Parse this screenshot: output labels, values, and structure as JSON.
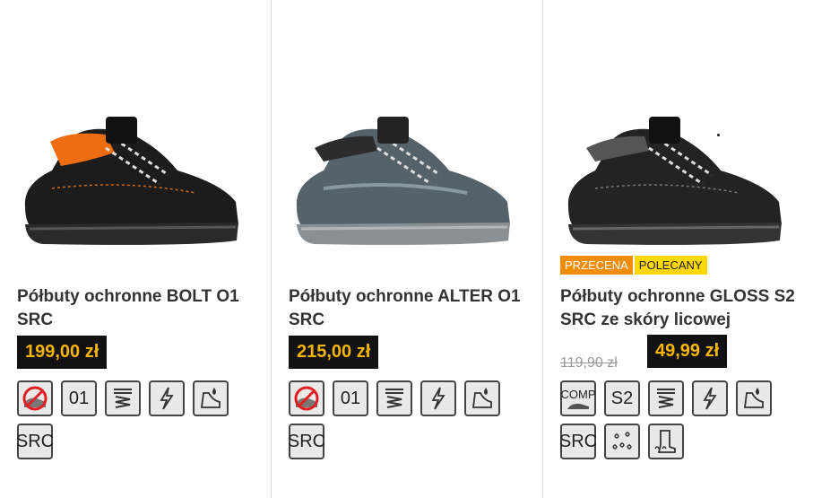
{
  "products": [
    {
      "title": "Półbuty ochronne BOLT O1 SRC",
      "price": "199,00 zł",
      "icons": [
        "no-steel-toe-icon",
        "o1-icon",
        "shock-absorption-icon",
        "antistatic-icon",
        "fuel-oil-resistance-icon",
        "src-icon"
      ],
      "icon_labels": [
        "",
        "01",
        "",
        "",
        "",
        "SRC"
      ],
      "image": "black-orange-safety-shoe"
    },
    {
      "title": "Półbuty ochronne ALTER O1 SRC",
      "price": "215,00 zł",
      "icons": [
        "no-steel-toe-icon",
        "o1-icon",
        "shock-absorption-icon",
        "antistatic-icon",
        "fuel-oil-resistance-icon",
        "src-icon"
      ],
      "icon_labels": [
        "",
        "01",
        "",
        "",
        "",
        "SRC"
      ],
      "image": "grey-suede-safety-shoe"
    },
    {
      "title": "Półbuty ochronne GLOSS S2 SRC ze skóry licowej",
      "old_price": "119,90 zł",
      "price": "49,99 zł",
      "badges": [
        "PRZECENA",
        "POLECANY"
      ],
      "icons": [
        "composite-toe-icon",
        "s2-icon",
        "shock-absorption-icon",
        "antistatic-icon",
        "fuel-oil-resistance-icon",
        "src-icon",
        "water-resistance-icon",
        "heat-sole-icon"
      ],
      "icon_labels": [
        "COMP",
        "S2",
        "",
        "",
        "",
        "SRC",
        "",
        ""
      ],
      "image": "black-leather-safety-shoe"
    }
  ],
  "colors": {
    "price_bg": "#111111",
    "price_text": "#f7b500",
    "badge_sale": "#f28c00",
    "badge_recommended": "#ffd800"
  }
}
